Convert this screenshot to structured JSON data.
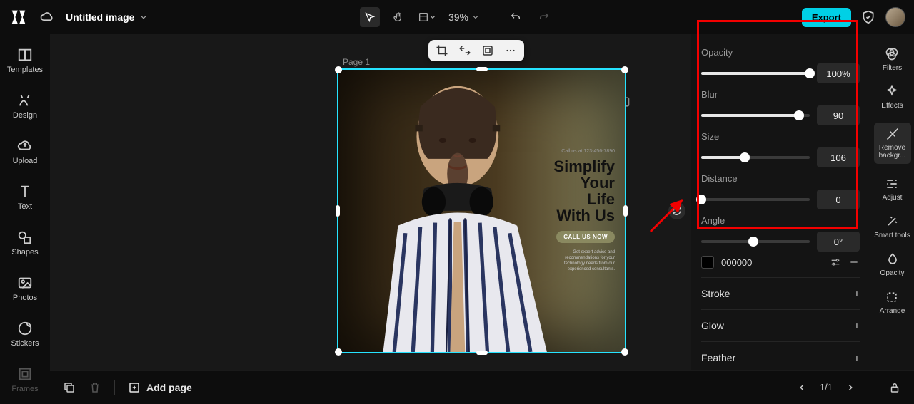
{
  "header": {
    "title": "Untitled image",
    "zoom": "39%",
    "export": "Export"
  },
  "leftRail": {
    "templates": "Templates",
    "design": "Design",
    "upload": "Upload",
    "text": "Text",
    "shapes": "Shapes",
    "photos": "Photos",
    "stickers": "Stickers",
    "frames": "Frames"
  },
  "rightRail": {
    "filters": "Filters",
    "effects": "Effects",
    "removeBg": "Remove backgr...",
    "adjust": "Adjust",
    "smartTools": "Smart tools",
    "opacity": "Opacity",
    "arrange": "Arrange"
  },
  "props": {
    "opacity": {
      "label": "Opacity",
      "value": "100%",
      "pct": 100
    },
    "blur": {
      "label": "Blur",
      "value": "90",
      "pct": 90
    },
    "size": {
      "label": "Size",
      "value": "106",
      "pct": 40
    },
    "distance": {
      "label": "Distance",
      "value": "0",
      "pct": 0
    },
    "angle": {
      "label": "Angle",
      "value": "0°",
      "pct": 48
    },
    "hex": "000000",
    "stroke": "Stroke",
    "glow": "Glow",
    "feather": "Feather"
  },
  "canvas": {
    "pageLabel": "Page 1",
    "phone": "Call us at 123-456-7890",
    "line1": "Simplify",
    "line2": "Your",
    "line3": "Life",
    "line4": "With Us",
    "cta": "CALL US NOW",
    "sub": "Get expert advice and recommendations for your technology needs from our experienced consultants."
  },
  "bottom": {
    "addPage": "Add page",
    "pager": "1/1"
  }
}
